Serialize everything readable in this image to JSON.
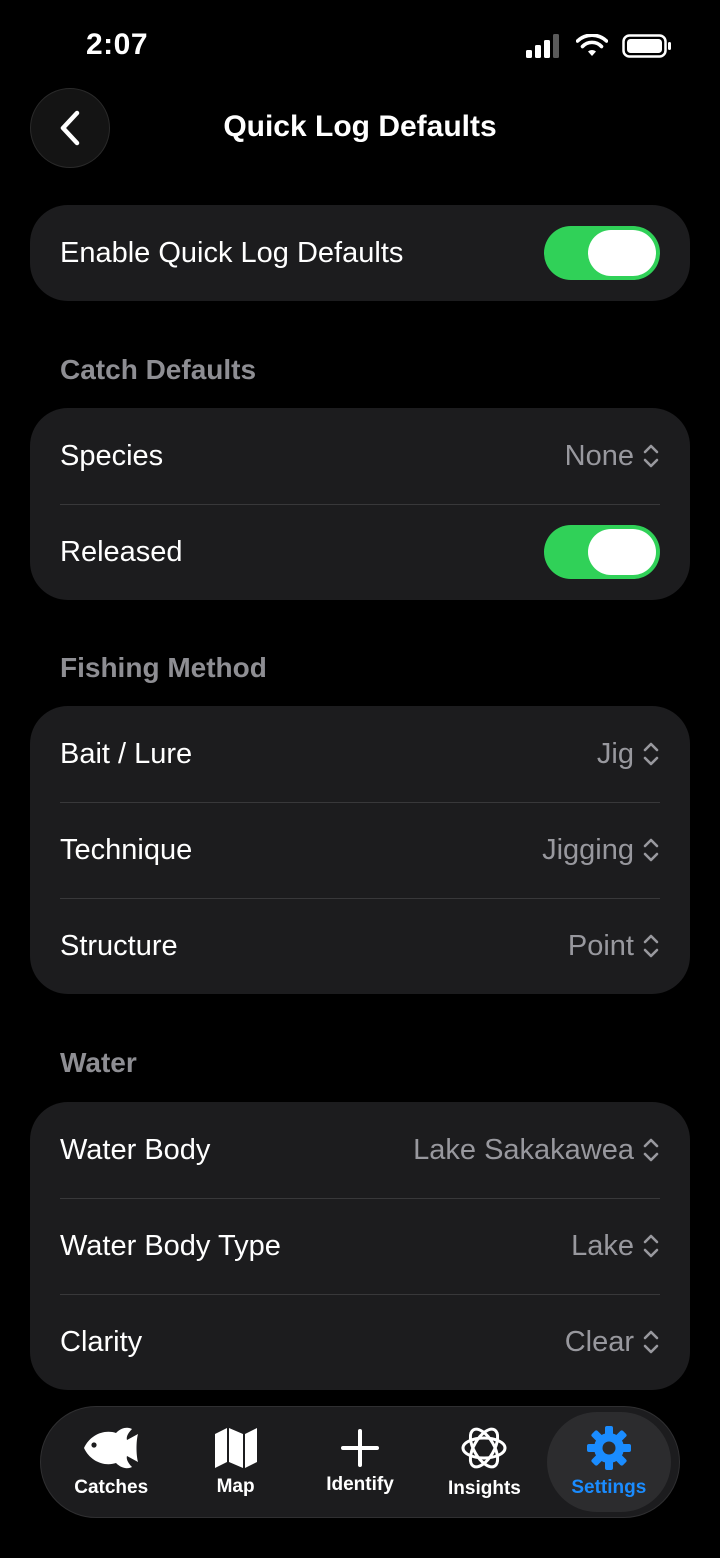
{
  "status": {
    "time": "2:07"
  },
  "header": {
    "title": "Quick Log Defaults"
  },
  "main_toggle": {
    "label": "Enable Quick Log Defaults",
    "on": true
  },
  "sections": {
    "catch": {
      "title": "Catch Defaults",
      "species": {
        "label": "Species",
        "value": "None"
      },
      "released": {
        "label": "Released",
        "on": true
      }
    },
    "fishing": {
      "title": "Fishing Method",
      "rows": [
        {
          "label": "Bait / Lure",
          "value": "Jig"
        },
        {
          "label": "Technique",
          "value": "Jigging"
        },
        {
          "label": "Structure",
          "value": "Point"
        }
      ]
    },
    "water": {
      "title": "Water",
      "rows": [
        {
          "label": "Water Body",
          "value": "Lake Sakakawea"
        },
        {
          "label": "Water Body Type",
          "value": "Lake"
        },
        {
          "label": "Clarity",
          "value": "Clear"
        }
      ]
    }
  },
  "tabs": [
    {
      "label": "Catches",
      "icon": "fish-icon"
    },
    {
      "label": "Map",
      "icon": "map-icon"
    },
    {
      "label": "Identify",
      "icon": "plus-icon"
    },
    {
      "label": "Insights",
      "icon": "atom-icon"
    },
    {
      "label": "Settings",
      "icon": "gear-icon",
      "active": true
    }
  ],
  "colors": {
    "accent_green": "#30d158",
    "accent_blue": "#1a8cff",
    "card_bg": "#1c1c1e"
  }
}
